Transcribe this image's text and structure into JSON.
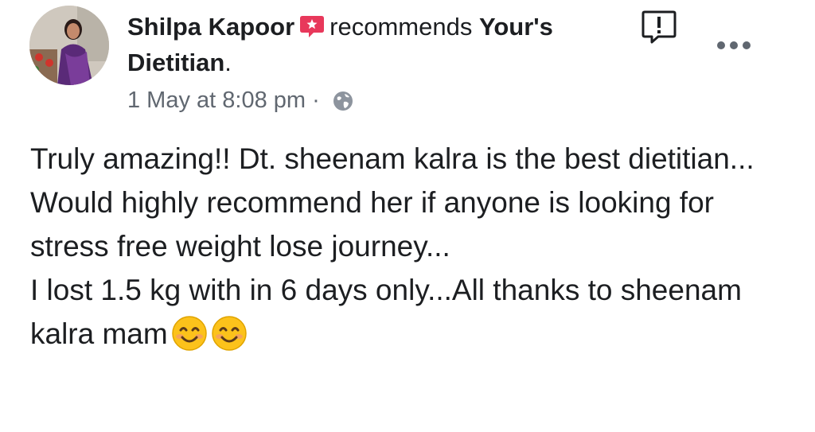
{
  "post": {
    "author": "Shilpa Kapoor",
    "action": "recommends",
    "page_name_part1": "Your's",
    "page_name_part2": "Dietitian",
    "period": ".",
    "timestamp": "1 May at 8:08 pm",
    "separator": "·",
    "audience_icon": "globe-icon",
    "recommend_icon": "recommendation-star-icon",
    "body_paragraph1": "Truly amazing!! Dt. sheenam kalra is the best dietitian... Would highly recommend her if anyone is looking for stress free weight lose journey...",
    "body_paragraph2": "I lost 1.5 kg with in 6 days only...All thanks to sheenam kalra mam",
    "emojis": [
      "smiling-face-emoji",
      "smiling-face-emoji"
    ]
  },
  "colors": {
    "recommend_red": "#e8385b",
    "text": "#1c1e21",
    "meta_gray": "#606770"
  }
}
